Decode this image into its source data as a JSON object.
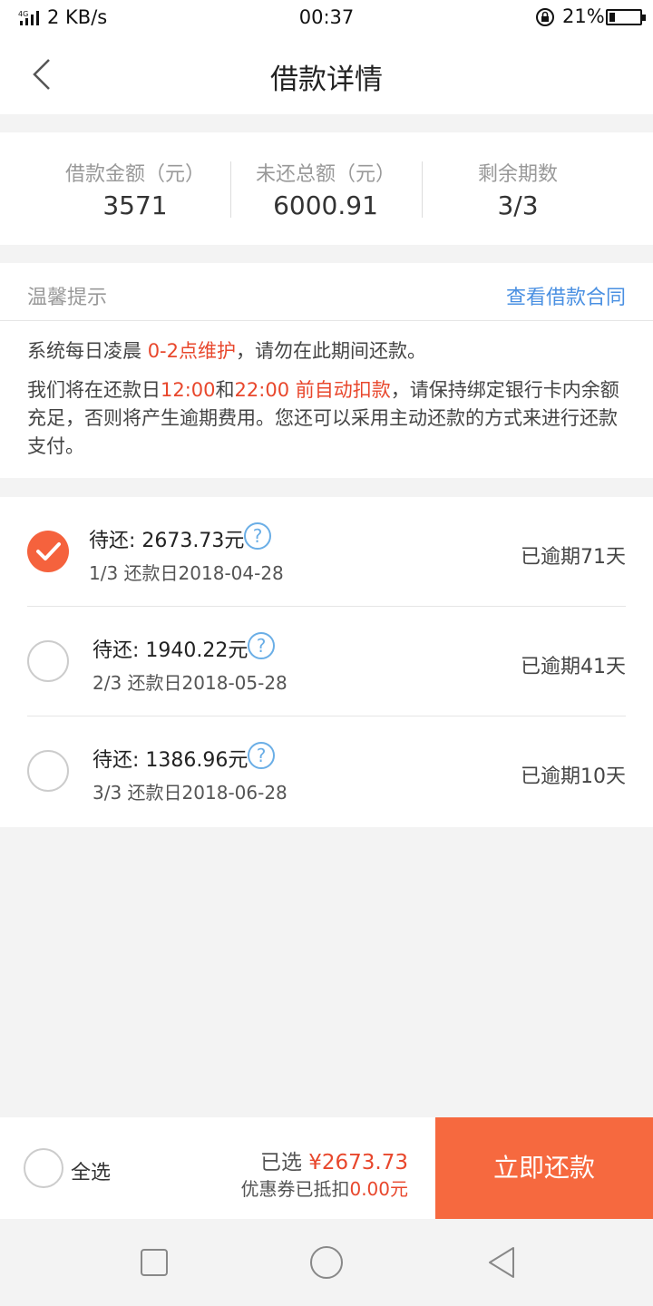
{
  "status_bar": {
    "network": "4G",
    "net_speed": "2 KB/s",
    "time": "00:37",
    "battery": "21%"
  },
  "nav": {
    "title": "借款详情",
    "back_icon": "chevron-left-icon"
  },
  "summary": {
    "items": [
      {
        "label": "借款金额（元）",
        "value": "3571"
      },
      {
        "label": "未还总额（元）",
        "value": "6000.91"
      },
      {
        "label": "剩余期数",
        "value": "3/3"
      }
    ]
  },
  "tips": {
    "title": "温馨提示",
    "contract_link": "查看借款合同",
    "line1": {
      "a": "系统每日凌晨 ",
      "b": "0-2点维护",
      "c": "，请勿在此期间还款。"
    },
    "line2": {
      "a": "我们将在还款日",
      "b": "12:00",
      "c": "和",
      "d": "22:00 前自动扣款",
      "e": "，请保持绑定银行卡内余额充足，否则将产生逾期费用。您还可以采用主动还款的方式来进行还款支付。"
    }
  },
  "installments": [
    {
      "due": "待还: 2673.73元",
      "period": "1/3  还款日2018-04-28",
      "status": "已逾期71天",
      "checked": true
    },
    {
      "due": "待还: 1940.22元",
      "period": "2/3  还款日2018-05-28",
      "status": "已逾期41天",
      "checked": false
    },
    {
      "due": "待还: 1386.96元",
      "period": "3/3  还款日2018-06-28",
      "status": "已逾期10天",
      "checked": false
    }
  ],
  "bottom": {
    "select_all": "全选",
    "selected_prefix": "已选 ",
    "selected_amount": "¥2673.73",
    "coupon_prefix": "优惠券已抵扣",
    "coupon_amount": "0.00元",
    "pay_button": "立即还款"
  },
  "colors": {
    "accent": "#f6693f",
    "highlight": "#e8472c",
    "link": "#4a90e2"
  }
}
